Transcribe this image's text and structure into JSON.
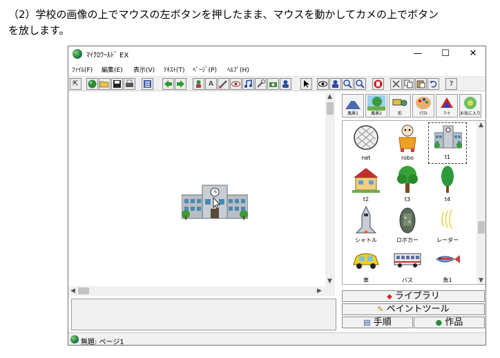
{
  "instruction": {
    "line1": "（2）学校の画像の上でマウスの左ボタンを押したまま、マウスを動かしてカメの上でボタン",
    "line2": "を放します。"
  },
  "window": {
    "title": "ﾏｲｸﾛﾜｰﾙﾄﾞ EX",
    "minimize": "—",
    "maximize": "☐",
    "close": "✕"
  },
  "menu": [
    "ﾌｧｲﾙ(F)",
    "編集(E)",
    "表示(V)",
    "ﾃｷｽﾄ(T)",
    "ﾍﾟｰｼﾞ(P)",
    "ﾍﾙﾌﾟ(H)"
  ],
  "categories": [
    "風景1",
    "風景2",
    "形",
    "ｲﾗｽﾄ",
    "ﾏｰｸ",
    "お気に入り"
  ],
  "library": [
    {
      "label": "net",
      "icon": "net-icon"
    },
    {
      "label": "robo",
      "icon": "robot-icon"
    },
    {
      "label": "t1",
      "icon": "school-icon"
    },
    {
      "label": "t2",
      "icon": "house-icon"
    },
    {
      "label": "t3",
      "icon": "tree-icon"
    },
    {
      "label": "t4",
      "icon": "tall-tree-icon"
    },
    {
      "label": "シャトル",
      "icon": "shuttle-icon"
    },
    {
      "label": "ロボカー",
      "icon": "robocar-icon"
    },
    {
      "label": "レーダー",
      "icon": "radar-icon"
    },
    {
      "label": "車",
      "icon": "car-icon"
    },
    {
      "label": "バス",
      "icon": "bus-icon"
    },
    {
      "label": "魚1",
      "icon": "fish-icon"
    }
  ],
  "panel_buttons": {
    "library": "ライブラリ",
    "paint": "ペイントツール",
    "steps": "手順",
    "works": "作品"
  },
  "status": "無題: ページ1",
  "colors": {
    "accent_green": "#2e8b3a",
    "school_gray": "#9aa0a6",
    "selected_border": "#333333"
  }
}
